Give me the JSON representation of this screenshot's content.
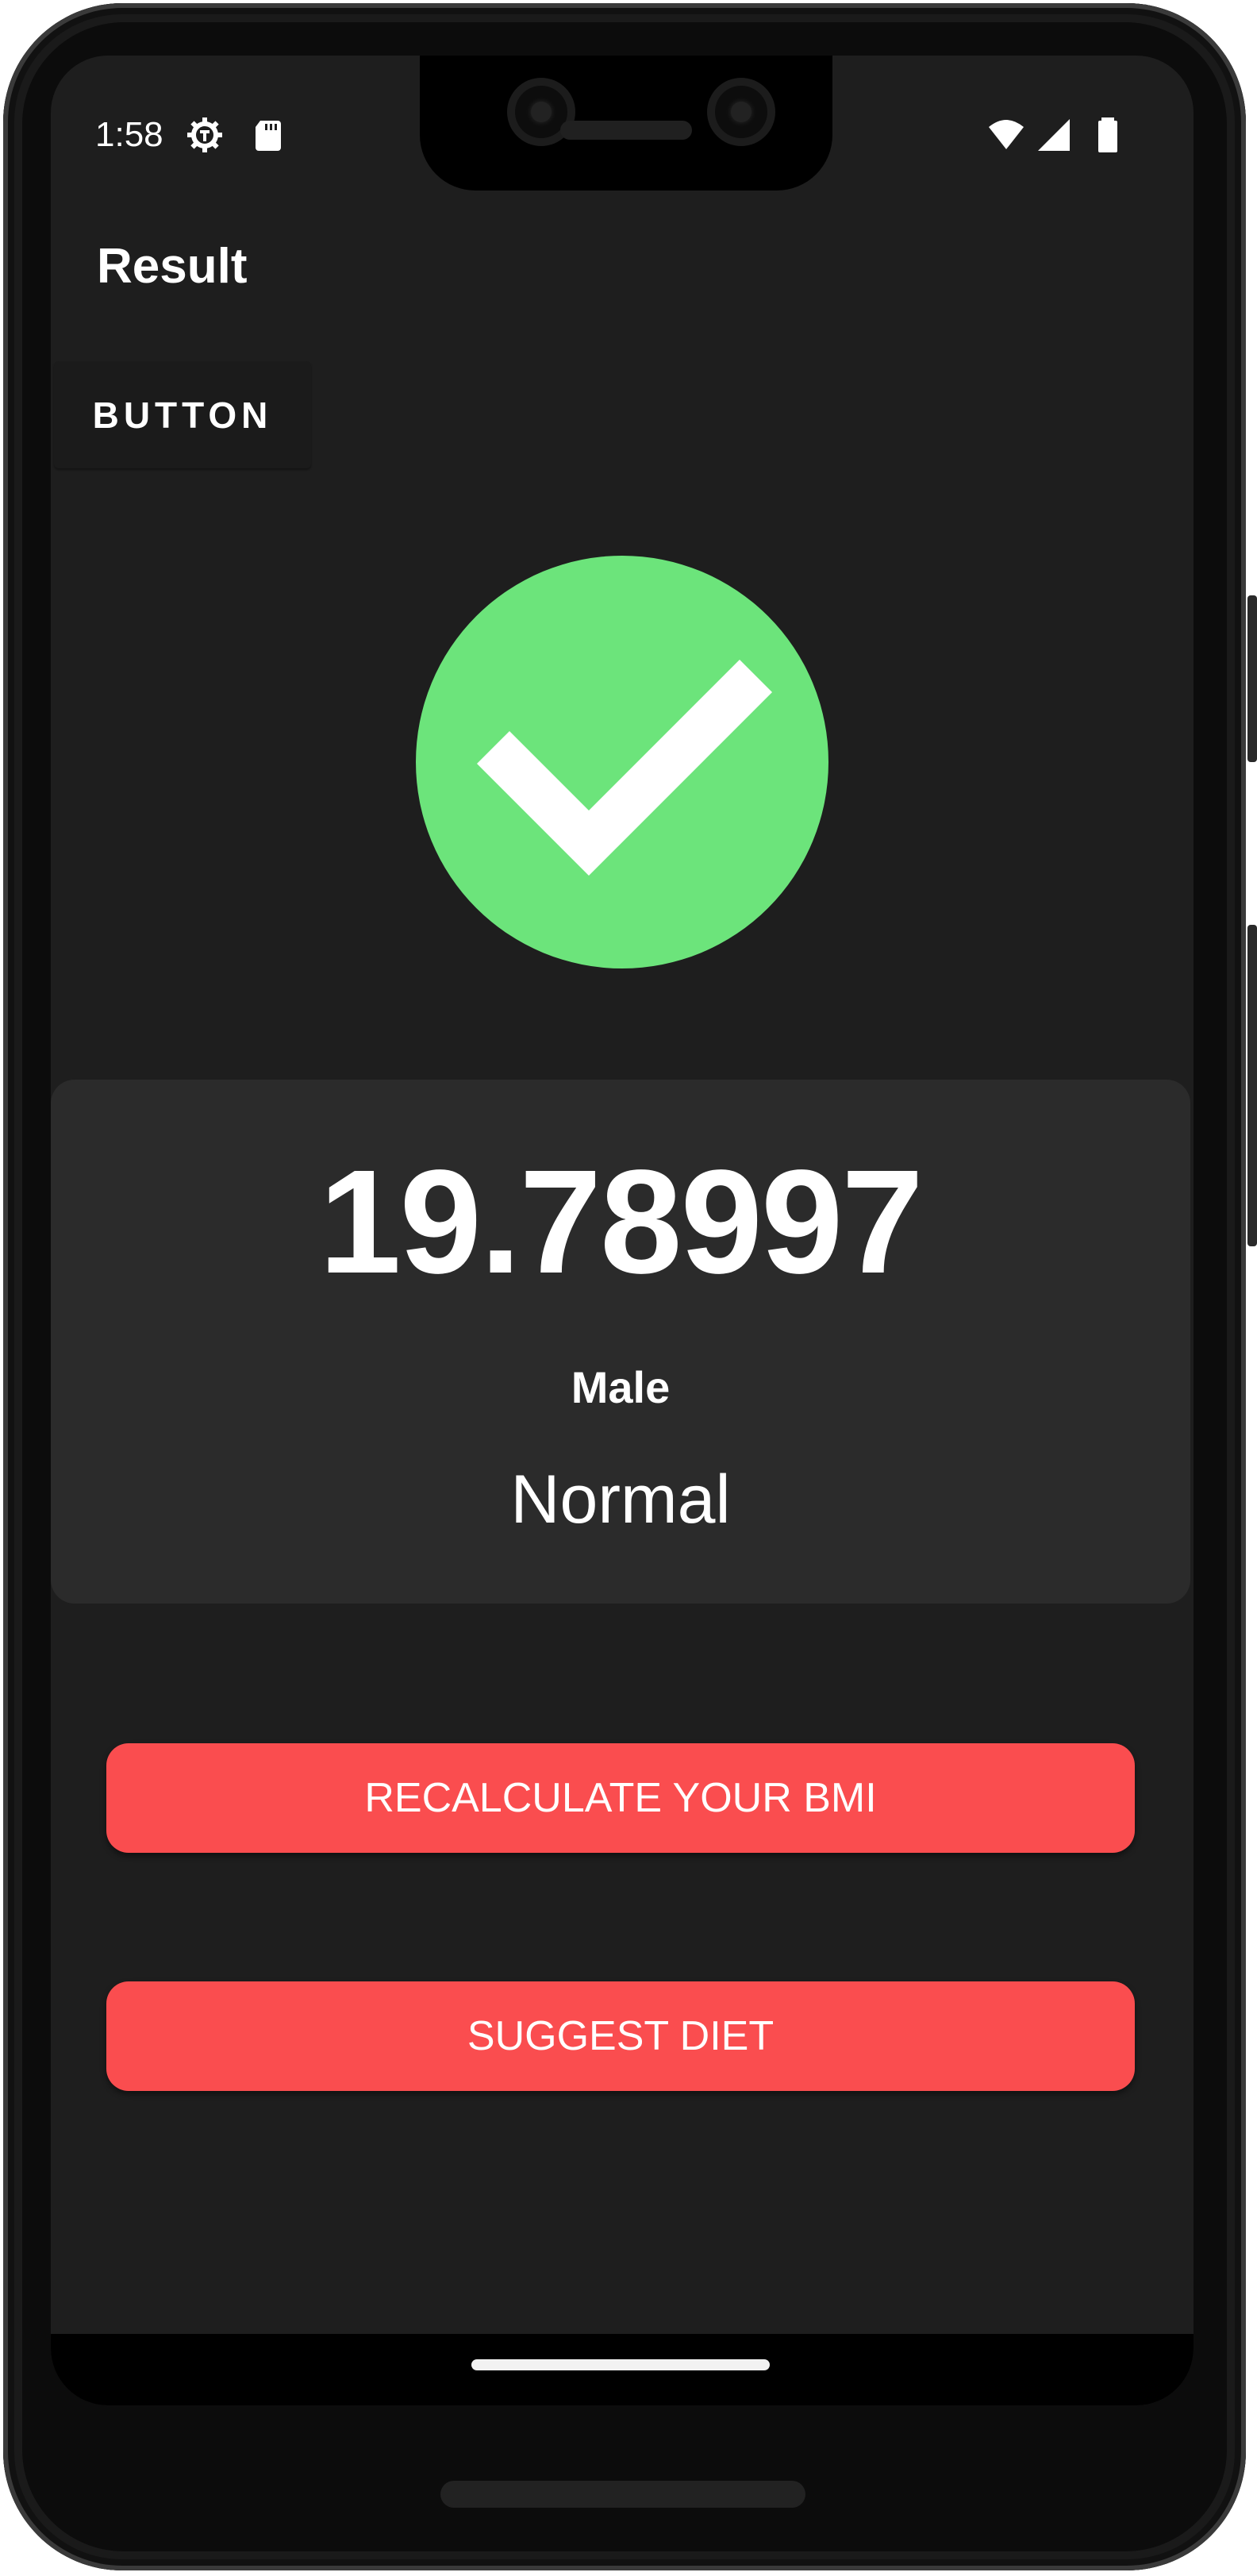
{
  "status_bar": {
    "time": "1:58",
    "icons": [
      "settings-icon",
      "sd-card-icon",
      "wifi-icon",
      "cell-signal-icon",
      "battery-icon"
    ]
  },
  "app_bar": {
    "title": "Result"
  },
  "top_button": {
    "label": "BUTTON"
  },
  "result": {
    "image": "check-circle-icon",
    "bmi_value": "19.78997",
    "gender": "Male",
    "category": "Normal"
  },
  "actions": {
    "recalculate_label": "RECALCULATE YOUR BMI",
    "suggest_diet_label": "SUGGEST DIET"
  },
  "colors": {
    "background": "#1e1e1e",
    "card": "#2b2b2b",
    "accent_red": "#fa4d4f",
    "check_green": "#6ce47b"
  }
}
